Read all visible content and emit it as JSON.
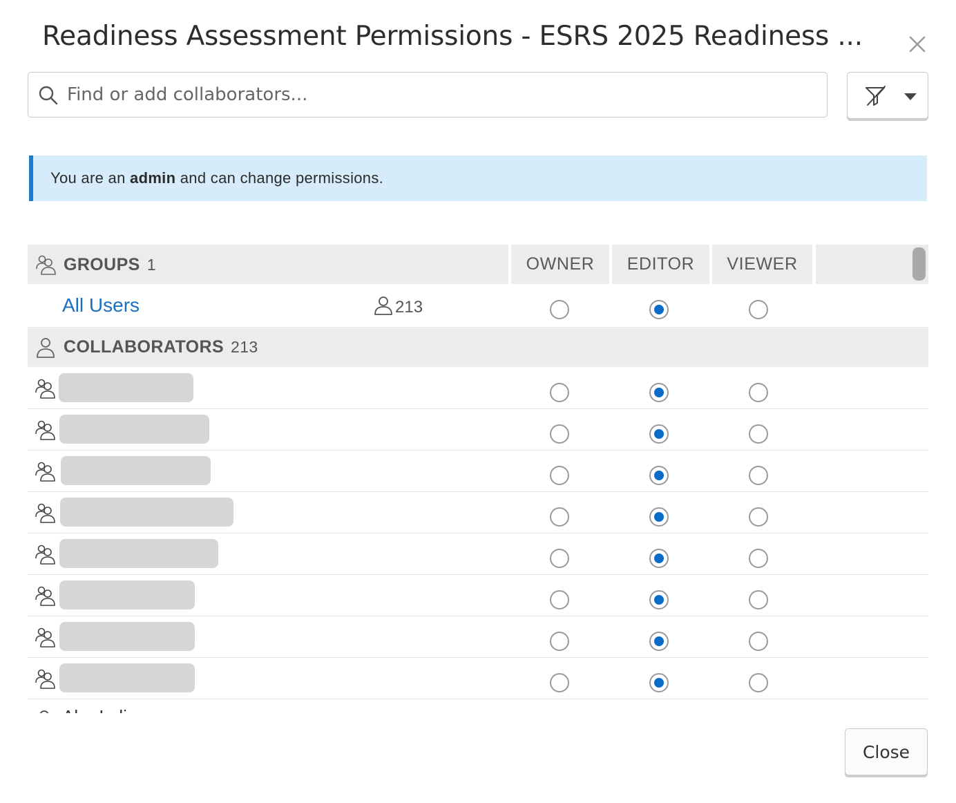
{
  "dialog": {
    "title": "Readiness Assessment Permissions - ESRS 2025 Readiness ...",
    "close_icon": "close-icon"
  },
  "search": {
    "placeholder": "Find or add collaborators...",
    "value": "",
    "icon": "search-icon"
  },
  "filter": {
    "icon": "filter-off-icon",
    "caret_icon": "chevron-down-icon"
  },
  "banner": {
    "prefix": "You are an",
    "role": "admin",
    "suffix": "and can change permissions.",
    "accent_color": "#1f7ccc",
    "background_color": "#d6ecfa"
  },
  "columns": {
    "owner": "OWNER",
    "editor": "EDITOR",
    "viewer": "VIEWER"
  },
  "groups": {
    "label": "GROUPS",
    "count": "1",
    "icon": "group-icon",
    "items": [
      {
        "name": "All Users",
        "member_count": "213",
        "member_icon": "user-icon",
        "permission": "editor"
      }
    ]
  },
  "collaborators": {
    "label": "COLLABORATORS",
    "count": "213",
    "icon": "user-icon",
    "items": [
      {
        "name": "",
        "icon": "group-icon",
        "permission": "editor",
        "redacted": true
      },
      {
        "name": "",
        "icon": "group-icon",
        "permission": "editor",
        "redacted": true
      },
      {
        "name": "",
        "icon": "group-icon",
        "permission": "editor",
        "redacted": true
      },
      {
        "name": "",
        "icon": "group-icon",
        "permission": "editor",
        "redacted": true
      },
      {
        "name": "",
        "icon": "group-icon",
        "permission": "editor",
        "redacted": true
      },
      {
        "name": "",
        "icon": "group-icon",
        "permission": "editor",
        "redacted": true
      },
      {
        "name": "",
        "icon": "group-icon",
        "permission": "editor",
        "redacted": true
      },
      {
        "name": "",
        "icon": "group-icon",
        "permission": "editor",
        "redacted": true
      }
    ],
    "partial_row_text": "Abe.Lalic"
  },
  "footer": {
    "close_label": "Close"
  },
  "colors": {
    "radio_selected": "#0b6bcb",
    "link": "#1a6fc4",
    "header_background": "#ececec"
  }
}
